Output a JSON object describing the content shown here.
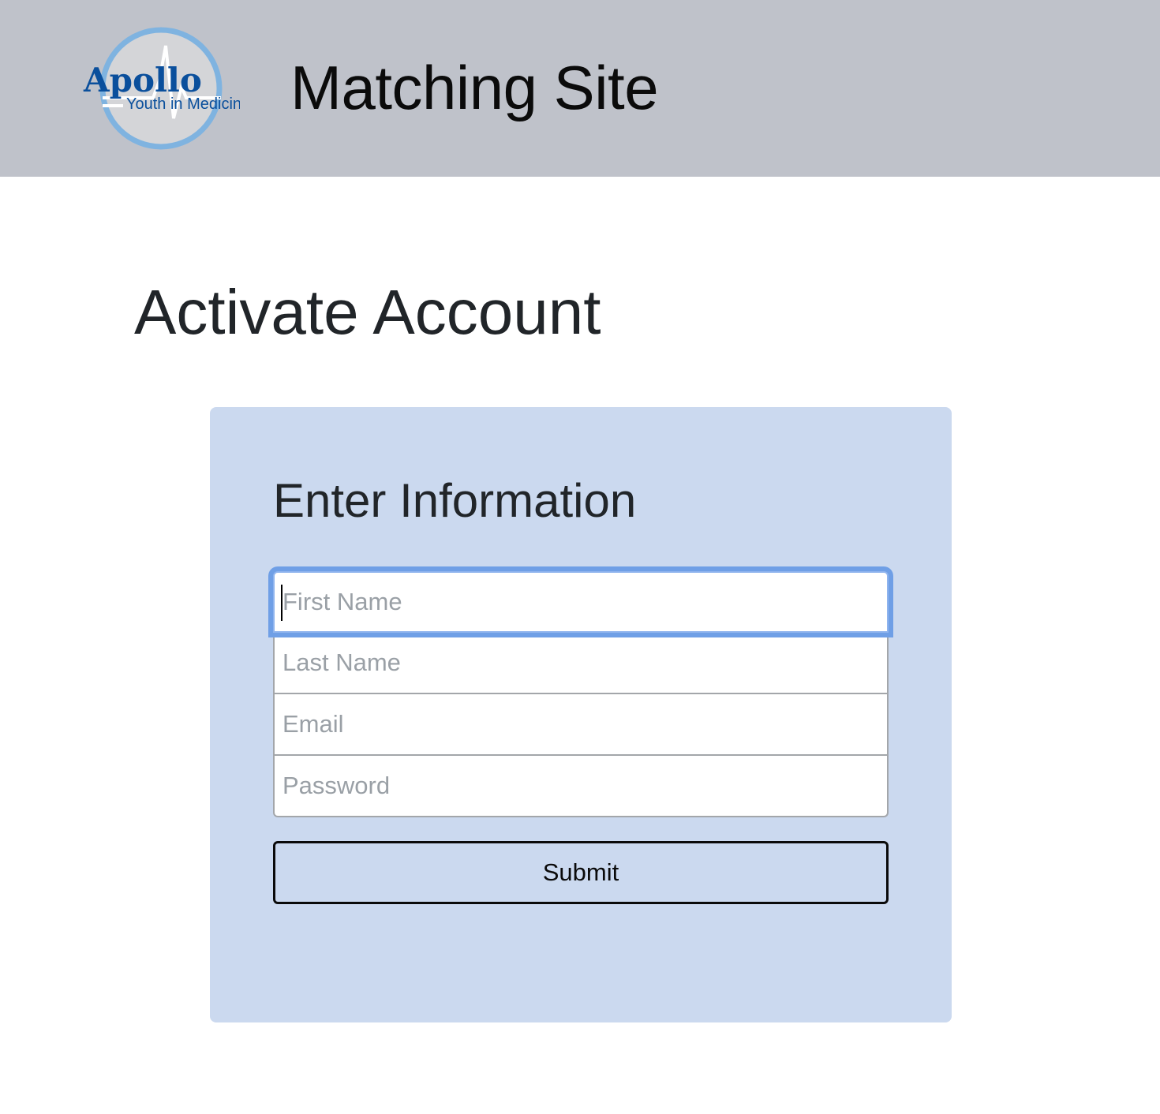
{
  "header": {
    "logo": {
      "name": "Apollo",
      "tagline": "Youth in Medicine",
      "colors": {
        "ring": "#7fb3e0",
        "text": "#0a4f9c",
        "fill": "#d4d5d8"
      }
    },
    "site_title": "Matching Site",
    "background": "#bfc2ca"
  },
  "main": {
    "page_title": "Activate Account",
    "card": {
      "title": "Enter Information",
      "background": "#cbd9ef",
      "fields": [
        {
          "placeholder": "First Name",
          "value": ""
        },
        {
          "placeholder": "Last Name",
          "value": ""
        },
        {
          "placeholder": "Email",
          "value": ""
        },
        {
          "placeholder": "Password",
          "value": ""
        }
      ],
      "submit_label": "Submit",
      "focus_color": "#6f9fe6"
    }
  }
}
